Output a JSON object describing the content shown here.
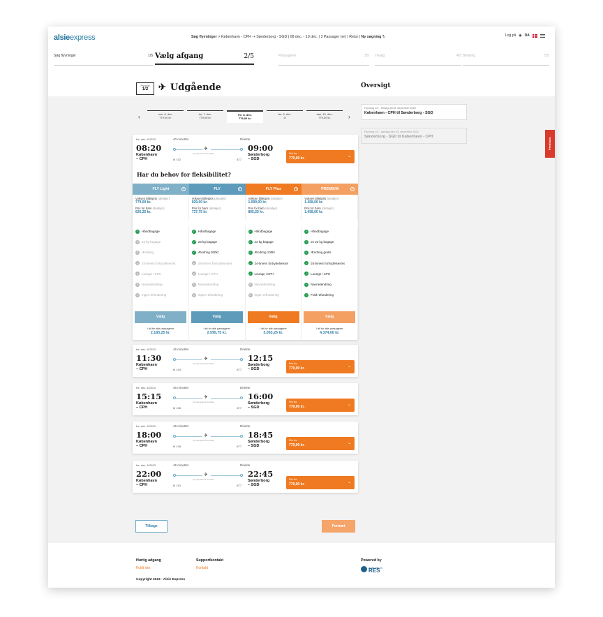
{
  "header": {
    "logo_a": "alsie",
    "logo_b": "express",
    "summary_a": "Søg flyvninger",
    "summary_b": " > København - CPH ⇢ Sønderborg - SGD | 08 dec. - 10 dec. | 3 Passager (er) | Retur | ",
    "new_search": "Ny søgning",
    "login": "Log på",
    "lang": "DA"
  },
  "steps": [
    {
      "label": "Søg flyvninger",
      "num": "1/5"
    },
    {
      "label": "Vælg afgang",
      "num": "2/5"
    },
    {
      "label": "Passagerer",
      "num": "3/5"
    },
    {
      "label": "Tilvalg",
      "num": "4/5"
    },
    {
      "label": "Betaling",
      "num": "5/5"
    }
  ],
  "leg": {
    "small": "Flyvning",
    "num": "1/2",
    "title": "Udgående"
  },
  "overview": {
    "title": "Oversigt",
    "cards": [
      {
        "sub": "Flyvning 1/2 - fredag den 8. december 2023",
        "title": "København - CPH til Sønderborg - SGD"
      },
      {
        "sub": "Flyvning 2/2 - søndag den 10. december 2023",
        "title": "Sønderborg - SGD til København - CPH"
      }
    ]
  },
  "dates": [
    {
      "d": "ons. 6. dec.",
      "p": "779,00 kr."
    },
    {
      "d": "tor. 7. dec.",
      "p": "779,00 kr."
    },
    {
      "d": "fre. 8. dec.",
      "p": "779,00 kr."
    },
    {
      "d": "lør. 9. dec.",
      "p": "⊘"
    },
    {
      "d": "søn. 10. dec.",
      "p": "779,00 kr."
    }
  ],
  "flights": [
    {
      "date": "fre. dec. 8 2023",
      "dep": "08:20",
      "dep_city": "København",
      "dep_code": "– CPH",
      "dur": "40 minutter",
      "direct": "Direkte",
      "oper": "Fly opereret af Air Alsie",
      "fno": "6I 102",
      "acft": "AT7",
      "arr": "09:00",
      "arr_city": "Sønderborg",
      "arr_code": "– SGD",
      "price_lbl": "Pris fra",
      "price": "779,00 kr."
    },
    {
      "date": "fre. dec. 8 2023",
      "dep": "11:30",
      "dep_city": "København",
      "dep_code": "– CPH",
      "dur": "45 minutter",
      "direct": "Direkte",
      "oper": "Fly opereret af Air Alsie",
      "fno": "6I 104",
      "acft": "AT7",
      "arr": "12:15",
      "arr_city": "Sønderborg",
      "arr_code": "– SGD",
      "price_lbl": "Pris fra",
      "price": "779,00 kr."
    },
    {
      "date": "fre. dec. 8 2023",
      "dep": "15:15",
      "dep_city": "København",
      "dep_code": "– CPH",
      "dur": "45 minutter",
      "direct": "Direkte",
      "oper": "Fly opereret af Air Alsie",
      "fno": "6I 106",
      "acft": "AT7",
      "arr": "16:00",
      "arr_city": "Sønderborg",
      "arr_code": "– SGD",
      "price_lbl": "Pris fra",
      "price": "779,00 kr."
    },
    {
      "date": "fre. dec. 8 2023",
      "dep": "18:00",
      "dep_city": "København",
      "dep_code": "– CPH",
      "dur": "45 minutter",
      "direct": "Direkte",
      "oper": "Fly opereret af Air Alsie",
      "fno": "6I 108",
      "acft": "AT7",
      "arr": "18:45",
      "arr_city": "Sønderborg",
      "arr_code": "– SGD",
      "price_lbl": "Pris fra",
      "price": "779,00 kr."
    },
    {
      "date": "fre. dec. 8 2023",
      "dep": "22:00",
      "dep_city": "København",
      "dep_code": "– CPH",
      "dur": "45 minutter",
      "direct": "Direkte",
      "oper": "Fly opereret af Air Alsie",
      "fno": "6I 110",
      "acft": "AT7",
      "arr": "22:45",
      "arr_city": "Sønderborg",
      "arr_code": "– SGD",
      "price_lbl": "Pris fra",
      "price": "779,00 kr."
    }
  ],
  "flex_q": "Har du behov for fleksibilitet?",
  "fares": [
    {
      "name": "FLY Light",
      "color": "#7fb0c8",
      "adult_lbl": "Voksen billetpris",
      "adult": "779,00 kr.",
      "child_lbl": "Pris for barn",
      "child": "625,25 kr.",
      "detail": "(detaljer)",
      "btn": "Vælg",
      "btn_color": "#7fb0c8",
      "tot_lbl": "I alt for alle passagerer",
      "total": "2.183,25 kr.",
      "feats": [
        [
          "Håndbagage",
          1
        ],
        [
          "23 kg bagage",
          0
        ],
        [
          "Ændring",
          0
        ],
        [
          "24-timers fortrydelsesret",
          0
        ],
        [
          "Lounge i CPH",
          0
        ],
        [
          "Navneændring",
          0
        ],
        [
          "Ingen refundering",
          0
        ]
      ]
    },
    {
      "name": "FLY",
      "color": "#5e9bbb",
      "adult_lbl": "Voksen billetpris",
      "adult": "929,00 kr.",
      "child_lbl": "Pris for barn",
      "child": "737,75 kr.",
      "detail": "(detaljer)",
      "btn": "Vælg",
      "btn_color": "#5e9bbb",
      "tot_lbl": "I alt for alle passagerer",
      "total": "2.595,75 kr.",
      "feats": [
        [
          "Håndbagage",
          1
        ],
        [
          "23 kg bagage",
          1
        ],
        [
          "Ændring 300kr",
          1
        ],
        [
          "24-timers fortrydelsesret",
          0
        ],
        [
          "Lounge i CPH",
          0
        ],
        [
          "Navneændring",
          0
        ],
        [
          "Ingen refundering",
          0
        ]
      ]
    },
    {
      "name": "FLY Plus",
      "color": "#ef7a21",
      "adult_lbl": "Voksen billetpris",
      "adult": "1.099,00 kr.",
      "child_lbl": "Pris for barn",
      "child": "865,25 kr.",
      "detail": "(detaljer)",
      "btn": "Vælg",
      "btn_color": "#ef7a21",
      "tot_lbl": "I alt for alle passagerer",
      "total": "3.063,25 kr.",
      "feats": [
        [
          "Håndbagage",
          1
        ],
        [
          "23 kg bagage",
          1
        ],
        [
          "Ændring 100kr",
          1
        ],
        [
          "24-timers fortrydelsesret",
          1
        ],
        [
          "Lounge i CPH",
          1
        ],
        [
          "Navneændring",
          0
        ],
        [
          "Ingen refundering",
          0
        ]
      ]
    },
    {
      "name": "PREMIUM",
      "color": "#f4a062",
      "adult_lbl": "Voksen billetpris",
      "adult": "1.458,00 kr.",
      "child_lbl": "Pris for barn",
      "child": "1.458,00 kr.",
      "detail": "(detaljer)",
      "btn": "Vælg",
      "btn_color": "#f4a062",
      "tot_lbl": "I alt for alle passagerer",
      "total": "4.374,00 kr.",
      "feats": [
        [
          "Håndbagage",
          1
        ],
        [
          "2x 23 kg bagage",
          1
        ],
        [
          "Ændring gratis",
          1
        ],
        [
          "24-timers fortrydelsesret",
          1
        ],
        [
          "Lounge i CPH",
          1
        ],
        [
          "Navneændring",
          1
        ],
        [
          "Fuld refundering",
          1
        ]
      ]
    }
  ],
  "buttons": {
    "back": "Tilbage",
    "next": "Fortsæt"
  },
  "feedback": "Feedback",
  "footer": {
    "quick": "Hurtig adgang",
    "quick_link": "Fuldt site",
    "support": "Supportkontakt",
    "support_link": "Kontakt",
    "powered": "Powered by",
    "res_small": "AMADEUS",
    "res": "RES",
    "copyright": "Copyright 2023 - Alsie Express"
  }
}
